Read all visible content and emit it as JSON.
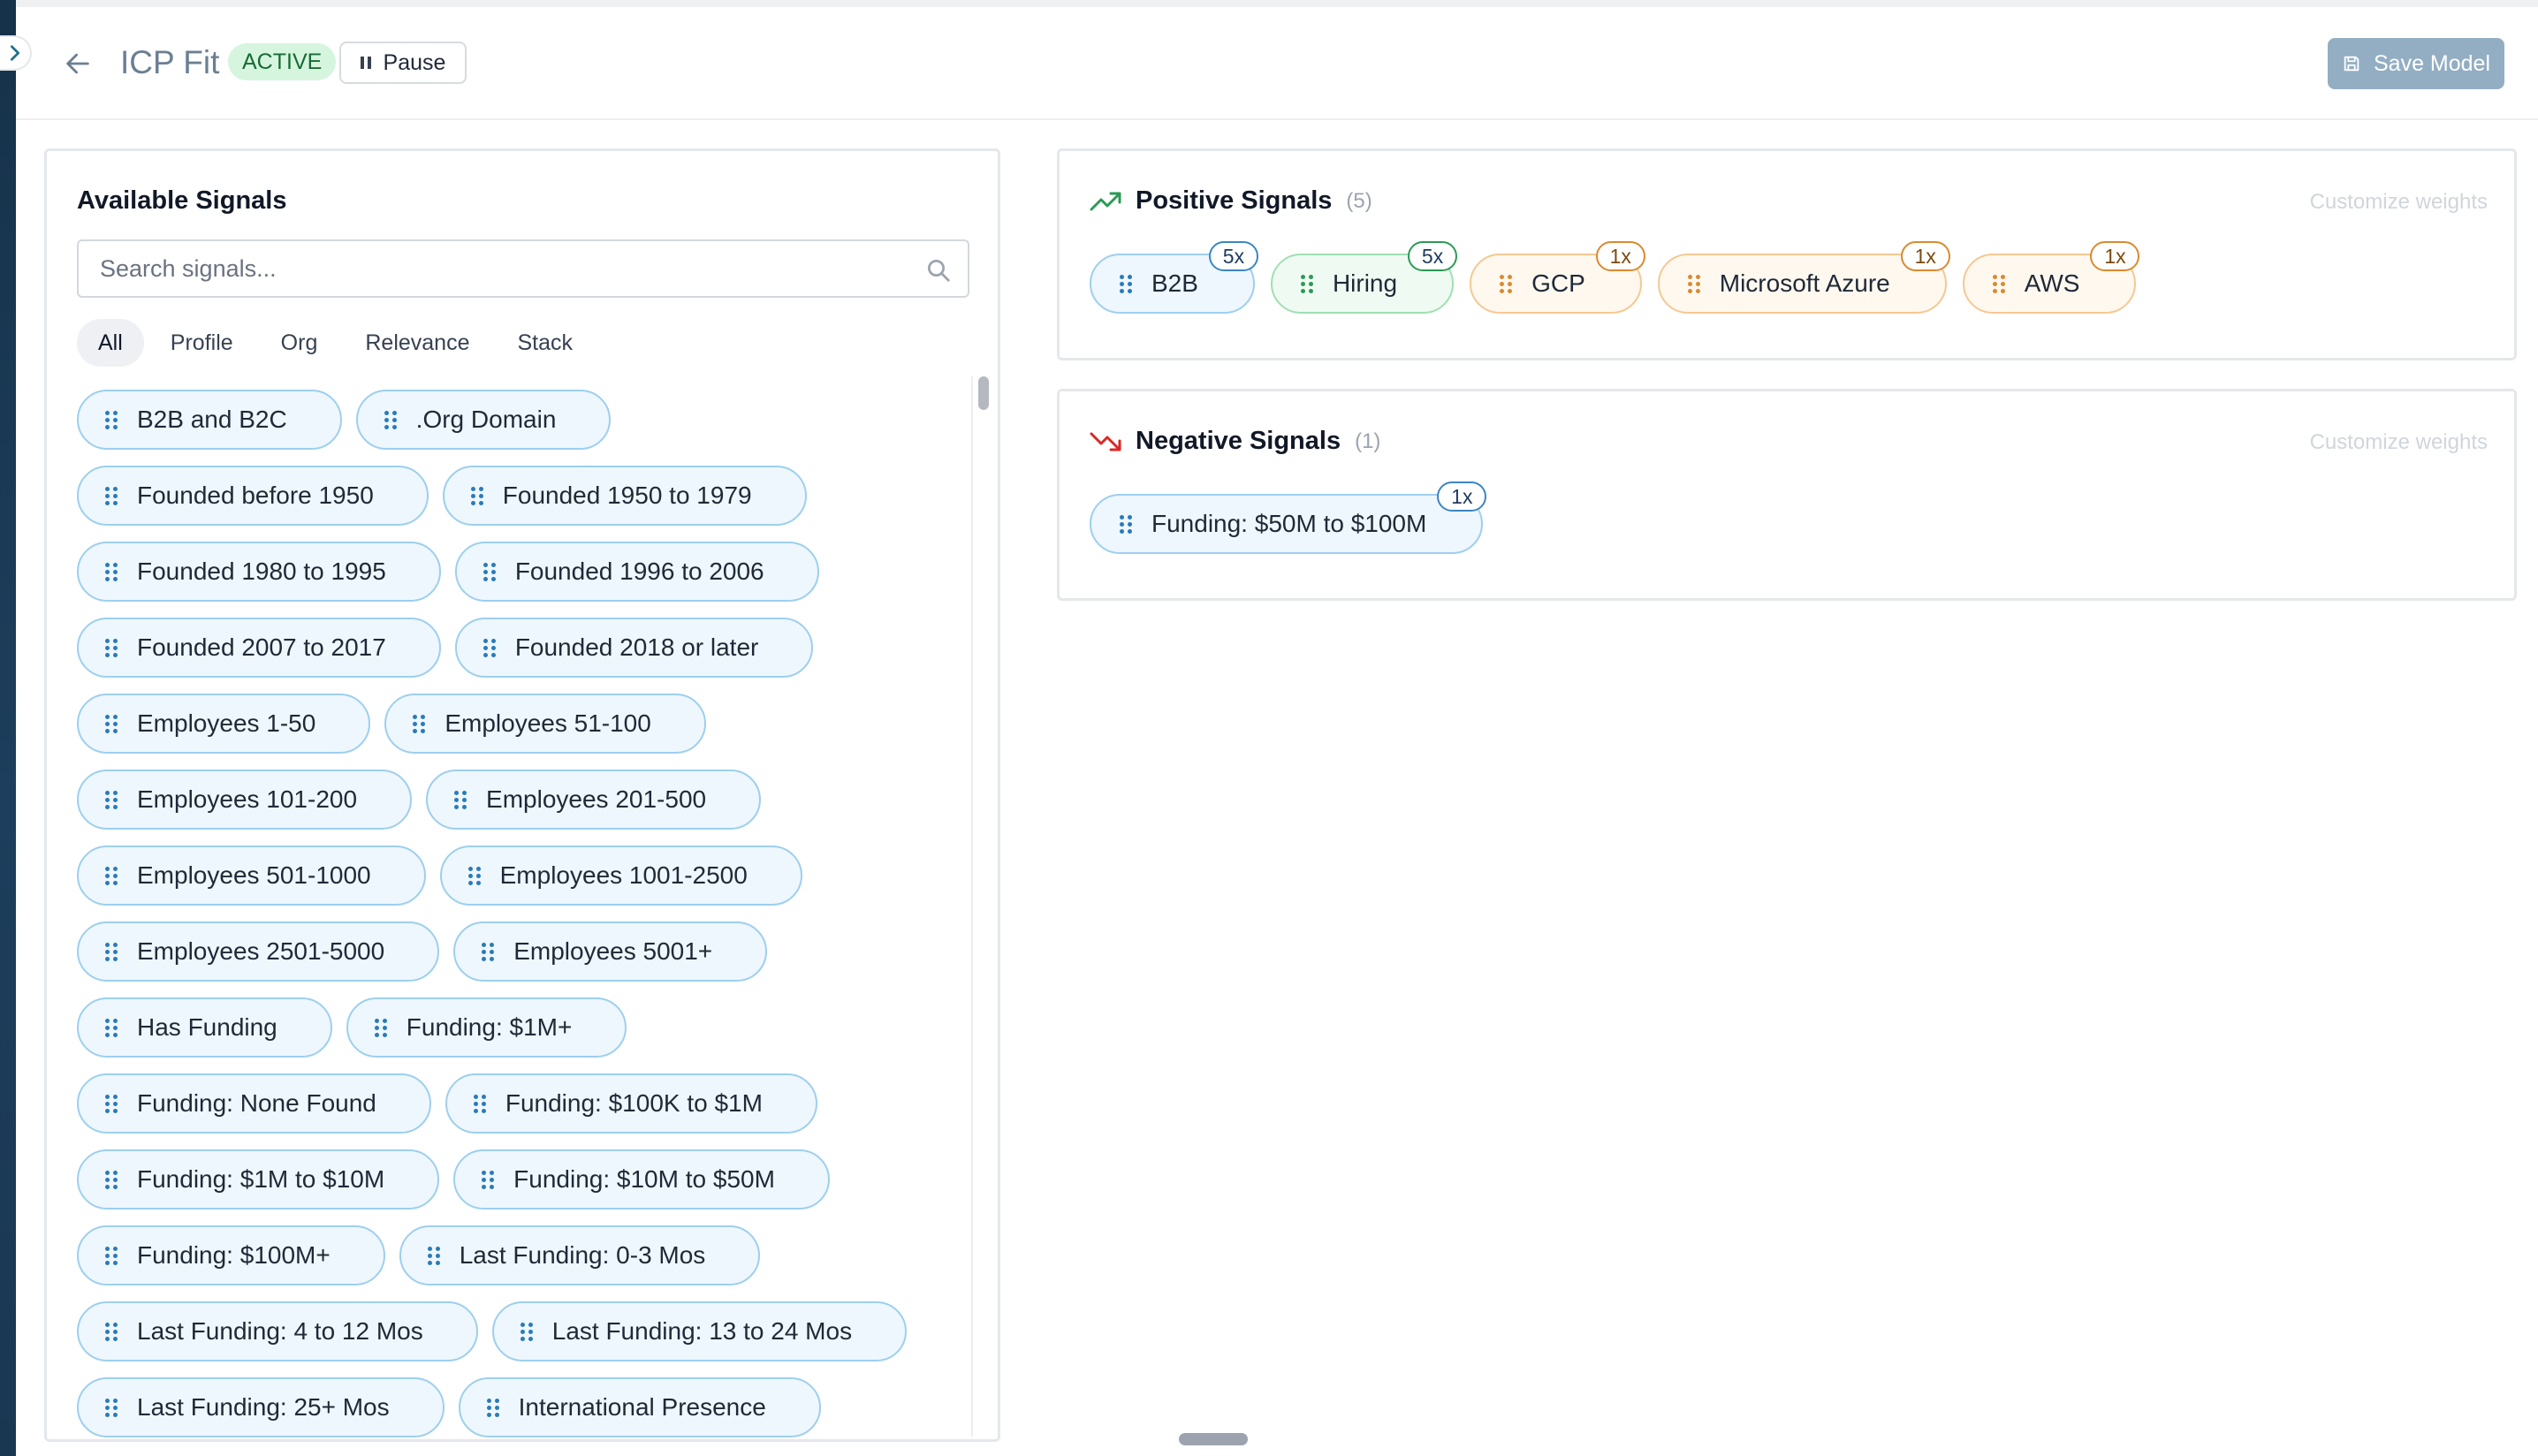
{
  "header": {
    "title": "ICP Fit",
    "status": "ACTIVE",
    "pause_label": "Pause",
    "save_label": "Save Model"
  },
  "available": {
    "title": "Available Signals",
    "search_placeholder": "Search signals...",
    "filters": [
      "All",
      "Profile",
      "Org",
      "Relevance",
      "Stack"
    ],
    "active_filter": "All",
    "rows": [
      [
        "B2B and B2C",
        ".Org Domain"
      ],
      [
        "Founded before 1950",
        "Founded 1950 to 1979"
      ],
      [
        "Founded 1980 to 1995",
        "Founded 1996 to 2006"
      ],
      [
        "Founded 2007 to 2017",
        "Founded 2018 or later"
      ],
      [
        "Employees 1-50",
        "Employees 51-100"
      ],
      [
        "Employees 101-200",
        "Employees 201-500"
      ],
      [
        "Employees 501-1000",
        "Employees 1001-2500"
      ],
      [
        "Employees 2501-5000",
        "Employees 5001+"
      ],
      [
        "Has Funding",
        "Funding: $1M+"
      ],
      [
        "Funding: None Found",
        "Funding: $100K to $1M"
      ],
      [
        "Funding: $1M to $10M",
        "Funding: $10M to $50M"
      ],
      [
        "Funding: $100M+",
        "Last Funding: 0-3 Mos"
      ],
      [
        "Last Funding: 4 to 12 Mos",
        "Last Funding: 13 to 24 Mos"
      ],
      [
        "Last Funding: 25+ Mos",
        "International Presence"
      ]
    ]
  },
  "positive": {
    "title": "Positive Signals",
    "count": "(5)",
    "customize_label": "Customize weights",
    "signals": [
      {
        "label": "B2B",
        "weight": "5x",
        "color": "blue"
      },
      {
        "label": "Hiring",
        "weight": "5x",
        "color": "green"
      },
      {
        "label": "GCP",
        "weight": "1x",
        "color": "orange"
      },
      {
        "label": "Microsoft Azure",
        "weight": "1x",
        "color": "orange"
      },
      {
        "label": "AWS",
        "weight": "1x",
        "color": "orange"
      }
    ]
  },
  "negative": {
    "title": "Negative Signals",
    "count": "(1)",
    "customize_label": "Customize weights",
    "signals": [
      {
        "label": "Funding: $50M to $100M",
        "weight": "1x",
        "color": "blue"
      }
    ]
  },
  "colors": {
    "positive_trend": "#2a9a55",
    "negative_trend": "#dc2626",
    "accent": "#2a7bb8",
    "save_button": "#93aec2"
  }
}
